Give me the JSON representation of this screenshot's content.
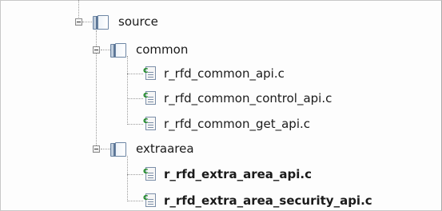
{
  "tree": {
    "root": {
      "label": "source",
      "expanded": true,
      "icon": "folder-icon"
    },
    "common": {
      "label": "common",
      "expanded": true,
      "icon": "folder-icon",
      "files": [
        {
          "label": "r_rfd_common_api.c",
          "bold": false
        },
        {
          "label": "r_rfd_common_control_api.c",
          "bold": false
        },
        {
          "label": "r_rfd_common_get_api.c",
          "bold": false
        }
      ]
    },
    "extraarea": {
      "label": "extraarea",
      "expanded": true,
      "icon": "folder-icon",
      "files": [
        {
          "label": "r_rfd_extra_area_api.c",
          "bold": true
        },
        {
          "label": "r_rfd_extra_area_security_api.c",
          "bold": true
        }
      ]
    },
    "file_icon": "c-source-file-icon",
    "colors": {
      "c_letter": "#1f8a26",
      "tree_line": "#9a9a9a",
      "folder_spine": "#5b7596"
    }
  }
}
